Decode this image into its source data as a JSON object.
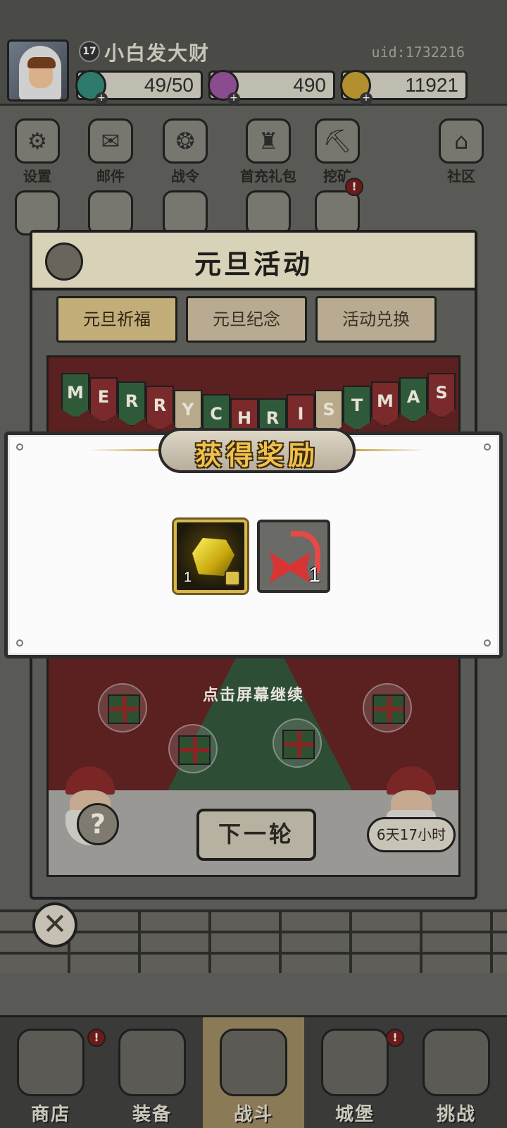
{
  "player": {
    "level": "17",
    "name": "小白发大财",
    "uid": "uid:1732216"
  },
  "resources": {
    "energy": "49/50",
    "gems": "490",
    "coins": "11921"
  },
  "menu": {
    "row1": [
      {
        "label": "设置",
        "icon": "gear-icon"
      },
      {
        "label": "邮件",
        "icon": "mail-icon"
      },
      {
        "label": "战令",
        "icon": "battle-pass-icon"
      },
      {
        "label": "首充礼包",
        "icon": "first-recharge-bag-icon"
      },
      {
        "label": "挖矿",
        "icon": "mining-icon"
      },
      {
        "label": "社区",
        "icon": "home-community-icon"
      }
    ],
    "badge": "!"
  },
  "event": {
    "title": "元旦活动",
    "tabs": [
      "元旦祈福",
      "元旦纪念",
      "活动兑换"
    ],
    "active_tab": 0,
    "banner_letters": [
      "M",
      "E",
      "R",
      "R",
      "Y",
      "C",
      "H",
      "R",
      "I",
      "S",
      "T",
      "M",
      "A",
      "S"
    ],
    "next_round": "下一轮",
    "help": "?",
    "timer": "6天17小时"
  },
  "reward_modal": {
    "title": "获得奖励",
    "continue_hint": "点击屏幕继续",
    "items": [
      {
        "name": "gold-ore",
        "qty": "1"
      },
      {
        "name": "candy-cane-bow",
        "qty": "1"
      }
    ]
  },
  "close_symbol": "✕",
  "bottom_nav": {
    "items": [
      {
        "label": "商店",
        "icon": "shop-icon",
        "badge": "!"
      },
      {
        "label": "装备",
        "icon": "backpack-icon",
        "badge": ""
      },
      {
        "label": "战斗",
        "icon": "crossed-swords-icon",
        "badge": ""
      },
      {
        "label": "城堡",
        "icon": "castle-icon",
        "badge": "!"
      },
      {
        "label": "挑战",
        "icon": "shield-icon",
        "badge": ""
      }
    ],
    "active_index": 2
  }
}
